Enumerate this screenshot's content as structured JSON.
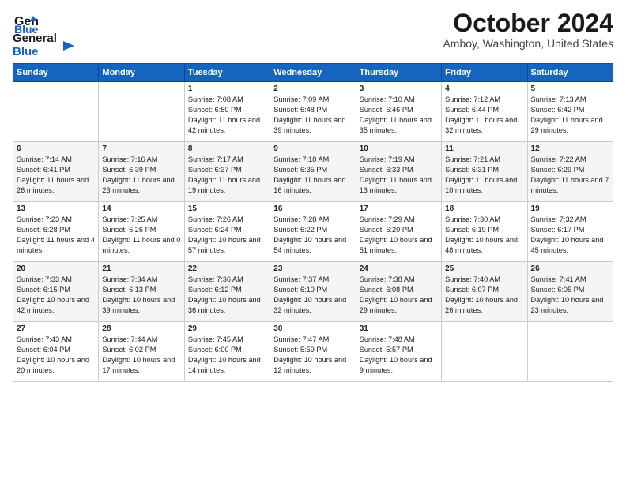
{
  "header": {
    "logo_line1": "General",
    "logo_line2": "Blue",
    "month": "October 2024",
    "location": "Amboy, Washington, United States"
  },
  "days_of_week": [
    "Sunday",
    "Monday",
    "Tuesday",
    "Wednesday",
    "Thursday",
    "Friday",
    "Saturday"
  ],
  "weeks": [
    [
      {
        "day": "",
        "content": ""
      },
      {
        "day": "",
        "content": ""
      },
      {
        "day": "1",
        "content": "Sunrise: 7:08 AM\nSunset: 6:50 PM\nDaylight: 11 hours and 42 minutes."
      },
      {
        "day": "2",
        "content": "Sunrise: 7:09 AM\nSunset: 6:48 PM\nDaylight: 11 hours and 39 minutes."
      },
      {
        "day": "3",
        "content": "Sunrise: 7:10 AM\nSunset: 6:46 PM\nDaylight: 11 hours and 35 minutes."
      },
      {
        "day": "4",
        "content": "Sunrise: 7:12 AM\nSunset: 6:44 PM\nDaylight: 11 hours and 32 minutes."
      },
      {
        "day": "5",
        "content": "Sunrise: 7:13 AM\nSunset: 6:42 PM\nDaylight: 11 hours and 29 minutes."
      }
    ],
    [
      {
        "day": "6",
        "content": "Sunrise: 7:14 AM\nSunset: 6:41 PM\nDaylight: 11 hours and 26 minutes."
      },
      {
        "day": "7",
        "content": "Sunrise: 7:16 AM\nSunset: 6:39 PM\nDaylight: 11 hours and 23 minutes."
      },
      {
        "day": "8",
        "content": "Sunrise: 7:17 AM\nSunset: 6:37 PM\nDaylight: 11 hours and 19 minutes."
      },
      {
        "day": "9",
        "content": "Sunrise: 7:18 AM\nSunset: 6:35 PM\nDaylight: 11 hours and 16 minutes."
      },
      {
        "day": "10",
        "content": "Sunrise: 7:19 AM\nSunset: 6:33 PM\nDaylight: 11 hours and 13 minutes."
      },
      {
        "day": "11",
        "content": "Sunrise: 7:21 AM\nSunset: 6:31 PM\nDaylight: 11 hours and 10 minutes."
      },
      {
        "day": "12",
        "content": "Sunrise: 7:22 AM\nSunset: 6:29 PM\nDaylight: 11 hours and 7 minutes."
      }
    ],
    [
      {
        "day": "13",
        "content": "Sunrise: 7:23 AM\nSunset: 6:28 PM\nDaylight: 11 hours and 4 minutes."
      },
      {
        "day": "14",
        "content": "Sunrise: 7:25 AM\nSunset: 6:26 PM\nDaylight: 11 hours and 0 minutes."
      },
      {
        "day": "15",
        "content": "Sunrise: 7:26 AM\nSunset: 6:24 PM\nDaylight: 10 hours and 57 minutes."
      },
      {
        "day": "16",
        "content": "Sunrise: 7:28 AM\nSunset: 6:22 PM\nDaylight: 10 hours and 54 minutes."
      },
      {
        "day": "17",
        "content": "Sunrise: 7:29 AM\nSunset: 6:20 PM\nDaylight: 10 hours and 51 minutes."
      },
      {
        "day": "18",
        "content": "Sunrise: 7:30 AM\nSunset: 6:19 PM\nDaylight: 10 hours and 48 minutes."
      },
      {
        "day": "19",
        "content": "Sunrise: 7:32 AM\nSunset: 6:17 PM\nDaylight: 10 hours and 45 minutes."
      }
    ],
    [
      {
        "day": "20",
        "content": "Sunrise: 7:33 AM\nSunset: 6:15 PM\nDaylight: 10 hours and 42 minutes."
      },
      {
        "day": "21",
        "content": "Sunrise: 7:34 AM\nSunset: 6:13 PM\nDaylight: 10 hours and 39 minutes."
      },
      {
        "day": "22",
        "content": "Sunrise: 7:36 AM\nSunset: 6:12 PM\nDaylight: 10 hours and 36 minutes."
      },
      {
        "day": "23",
        "content": "Sunrise: 7:37 AM\nSunset: 6:10 PM\nDaylight: 10 hours and 32 minutes."
      },
      {
        "day": "24",
        "content": "Sunrise: 7:38 AM\nSunset: 6:08 PM\nDaylight: 10 hours and 29 minutes."
      },
      {
        "day": "25",
        "content": "Sunrise: 7:40 AM\nSunset: 6:07 PM\nDaylight: 10 hours and 26 minutes."
      },
      {
        "day": "26",
        "content": "Sunrise: 7:41 AM\nSunset: 6:05 PM\nDaylight: 10 hours and 23 minutes."
      }
    ],
    [
      {
        "day": "27",
        "content": "Sunrise: 7:43 AM\nSunset: 6:04 PM\nDaylight: 10 hours and 20 minutes."
      },
      {
        "day": "28",
        "content": "Sunrise: 7:44 AM\nSunset: 6:02 PM\nDaylight: 10 hours and 17 minutes."
      },
      {
        "day": "29",
        "content": "Sunrise: 7:45 AM\nSunset: 6:00 PM\nDaylight: 10 hours and 14 minutes."
      },
      {
        "day": "30",
        "content": "Sunrise: 7:47 AM\nSunset: 5:59 PM\nDaylight: 10 hours and 12 minutes."
      },
      {
        "day": "31",
        "content": "Sunrise: 7:48 AM\nSunset: 5:57 PM\nDaylight: 10 hours and 9 minutes."
      },
      {
        "day": "",
        "content": ""
      },
      {
        "day": "",
        "content": ""
      }
    ]
  ]
}
